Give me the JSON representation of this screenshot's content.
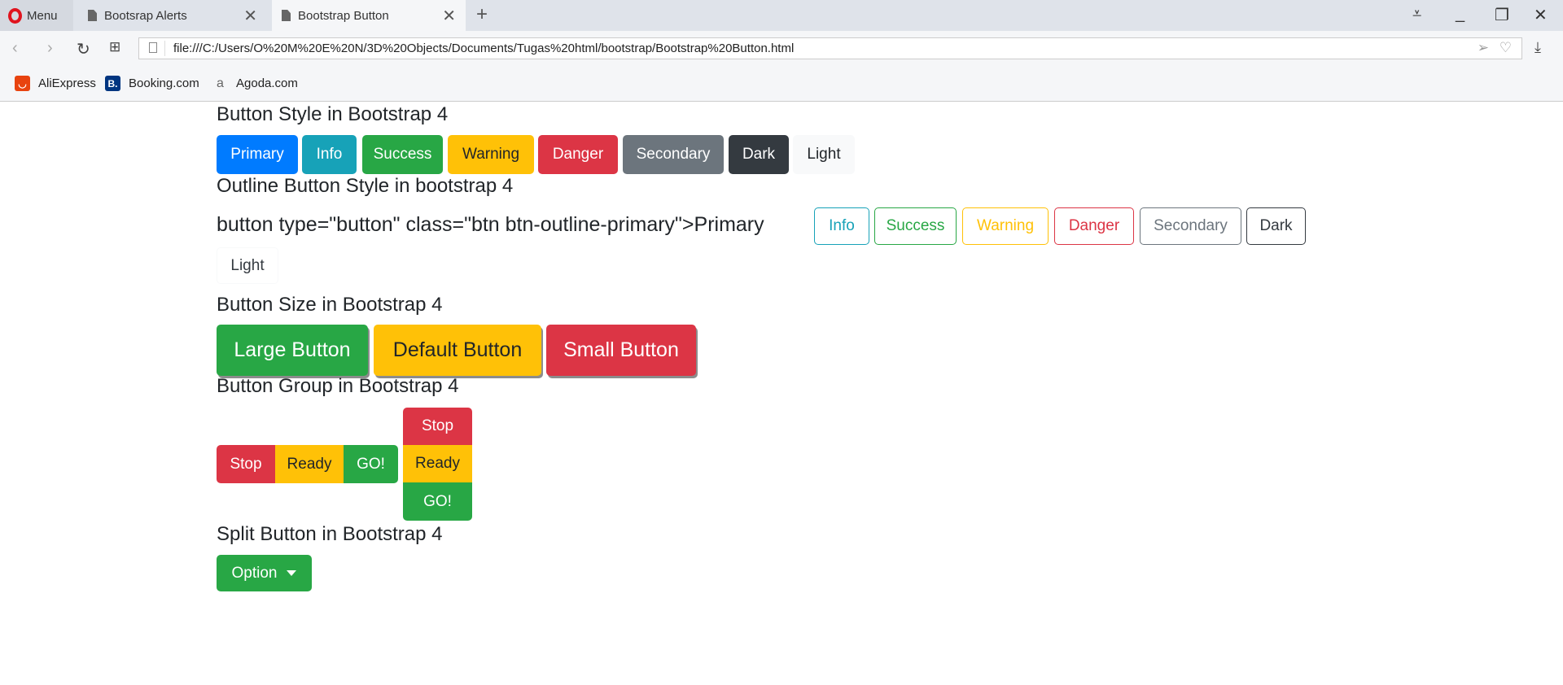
{
  "browser": {
    "menu_label": "Menu",
    "tabs": [
      {
        "title": "Bootsrap Alerts"
      },
      {
        "title": "Bootstrap Button"
      }
    ],
    "url": "file:///C:/Users/O%20M%20E%20N/3D%20Objects/Documents/Tugas%20html/bootstrap/Bootstrap%20Button.html",
    "bookmarks": [
      {
        "label": "AliExpress"
      },
      {
        "label": "Booking.com",
        "icon_text": "B."
      },
      {
        "label": "Agoda.com",
        "icon_text": "a"
      }
    ]
  },
  "sections": {
    "styles": {
      "title": "Button Style in Bootstrap 4",
      "buttons": [
        "Primary",
        "Info",
        "Success",
        "Warning",
        "Danger",
        "Secondary",
        "Dark",
        "Light"
      ]
    },
    "outline": {
      "title": "Outline Button Style in bootstrap 4",
      "raw_text": "button type=\"button\" class=\"btn btn-outline-primary\">Primary",
      "buttons": [
        "Info",
        "Success",
        "Warning",
        "Danger",
        "Secondary",
        "Dark",
        "Light"
      ]
    },
    "sizes": {
      "title": "Button Size in Bootstrap 4",
      "buttons": [
        "Large Button",
        "Default Button",
        "Small Button"
      ]
    },
    "group": {
      "title": "Button Group in Bootstrap 4",
      "horizontal": [
        "Stop",
        "Ready",
        "GO!"
      ],
      "vertical": [
        "Stop",
        "Ready",
        "GO!"
      ]
    },
    "split": {
      "title": "Split Button in Bootstrap 4",
      "button": "Option"
    }
  },
  "colors": {
    "primary": "#007bff",
    "info": "#17a2b8",
    "success": "#28a745",
    "warning": "#ffc107",
    "danger": "#dc3545",
    "secondary": "#6c757d",
    "dark": "#343a40",
    "light": "#f8f9fa"
  }
}
